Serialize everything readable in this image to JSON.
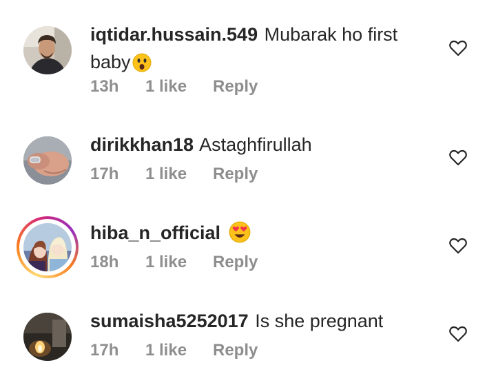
{
  "comments": [
    {
      "username": "iqtidar.hussain.549",
      "text": "Mubarak ho first baby",
      "emoji": "astonished-face-emoji",
      "time": "13h",
      "likes": "1 like",
      "reply": "Reply",
      "avatar": "man-portrait-avatar"
    },
    {
      "username": "dirikkhan18",
      "text": "Astaghfirullah",
      "time": "17h",
      "likes": "1 like",
      "reply": "Reply",
      "avatar": "hands-avatar"
    },
    {
      "username": "hiba_n_official",
      "text": "",
      "emoji": "heart-eyes-emoji",
      "time": "18h",
      "likes": "1 like",
      "reply": "Reply",
      "avatar": "frozen-sisters-avatar",
      "story_ring": true
    },
    {
      "username": "sumaisha5252017",
      "text": "Is she pregnant",
      "time": "17h",
      "likes": "1 like",
      "reply": "Reply",
      "avatar": "candle-avatar"
    }
  ],
  "colors": {
    "text": "#262626",
    "meta": "#8e8e8e",
    "story_ring_start": "#feda75",
    "story_ring_end": "#d62976"
  }
}
